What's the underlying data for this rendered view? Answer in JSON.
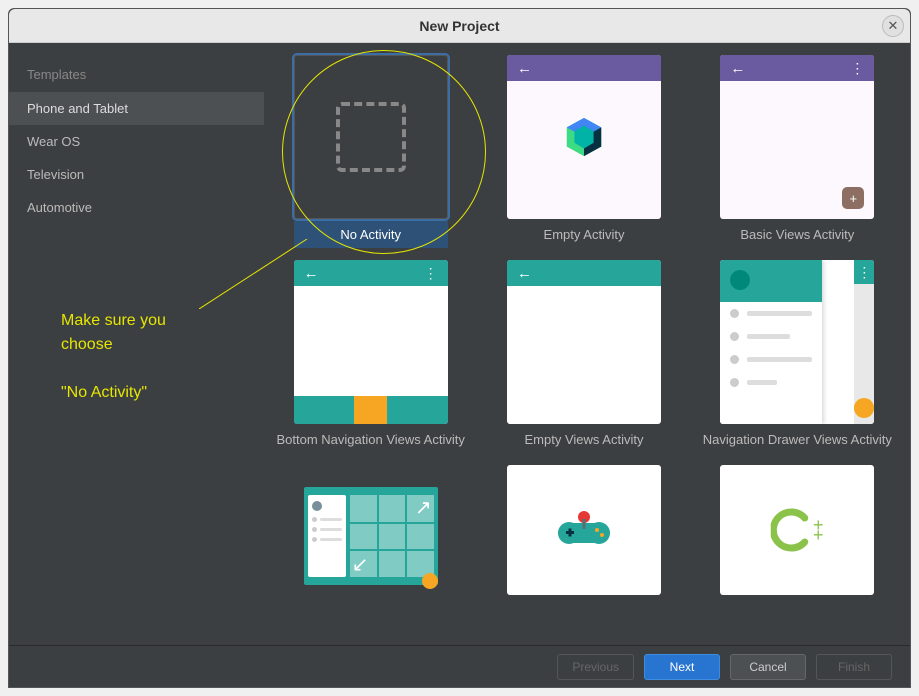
{
  "titlebar": {
    "title": "New Project"
  },
  "sidebar": {
    "header": "Templates",
    "items": [
      {
        "label": "Phone and Tablet",
        "selected": true
      },
      {
        "label": "Wear OS",
        "selected": false
      },
      {
        "label": "Television",
        "selected": false
      },
      {
        "label": "Automotive",
        "selected": false
      }
    ]
  },
  "templates": [
    {
      "label": "No Activity",
      "selected": true
    },
    {
      "label": "Empty Activity",
      "selected": false
    },
    {
      "label": "Basic Views Activity",
      "selected": false
    },
    {
      "label": "Bottom Navigation Views Activity",
      "selected": false
    },
    {
      "label": "Empty Views Activity",
      "selected": false
    },
    {
      "label": "Navigation Drawer Views Activity",
      "selected": false
    },
    {
      "label": "",
      "selected": false
    },
    {
      "label": "",
      "selected": false
    },
    {
      "label": "",
      "selected": false
    }
  ],
  "footer": {
    "previous": "Previous",
    "next": "Next",
    "cancel": "Cancel",
    "finish": "Finish"
  },
  "annotation": {
    "line1": "Make sure you",
    "line2": "choose",
    "line3": "\"No Activity\""
  }
}
